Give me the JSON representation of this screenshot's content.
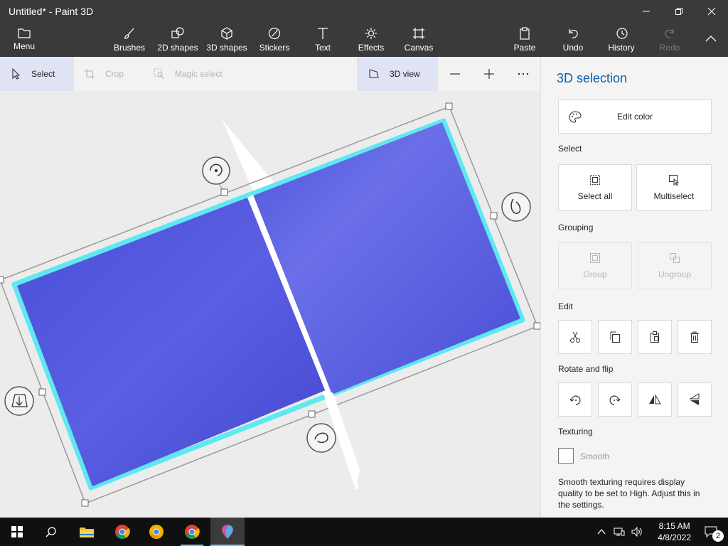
{
  "window": {
    "title": "Untitled* - Paint 3D"
  },
  "ribbon": {
    "menu": "Menu",
    "brushes": "Brushes",
    "shapes2d": "2D shapes",
    "shapes3d": "3D shapes",
    "stickers": "Stickers",
    "text": "Text",
    "effects": "Effects",
    "canvas": "Canvas",
    "paste": "Paste",
    "undo": "Undo",
    "history": "History",
    "redo": "Redo"
  },
  "toolbar": {
    "select": "Select",
    "crop": "Crop",
    "magic_select": "Magic select",
    "view3d": "3D view"
  },
  "panel": {
    "title": "3D selection",
    "edit_color": "Edit color",
    "select_heading": "Select",
    "select_all": "Select all",
    "multiselect": "Multiselect",
    "grouping_heading": "Grouping",
    "group": "Group",
    "ungroup": "Ungroup",
    "edit_heading": "Edit",
    "rotate_heading": "Rotate and flip",
    "texturing_heading": "Texturing",
    "smooth_label": "Smooth",
    "smooth_checked": false,
    "note": "Smooth texturing requires display quality to be set to High. Adjust this in the settings."
  },
  "taskbar": {
    "time": "8:15 AM",
    "date": "4/8/2022",
    "notifications": "2"
  },
  "colors": {
    "accent": "#0a60b0",
    "shape_fill": "#5a5fe0",
    "selection_glow": "#5fe8f0"
  }
}
